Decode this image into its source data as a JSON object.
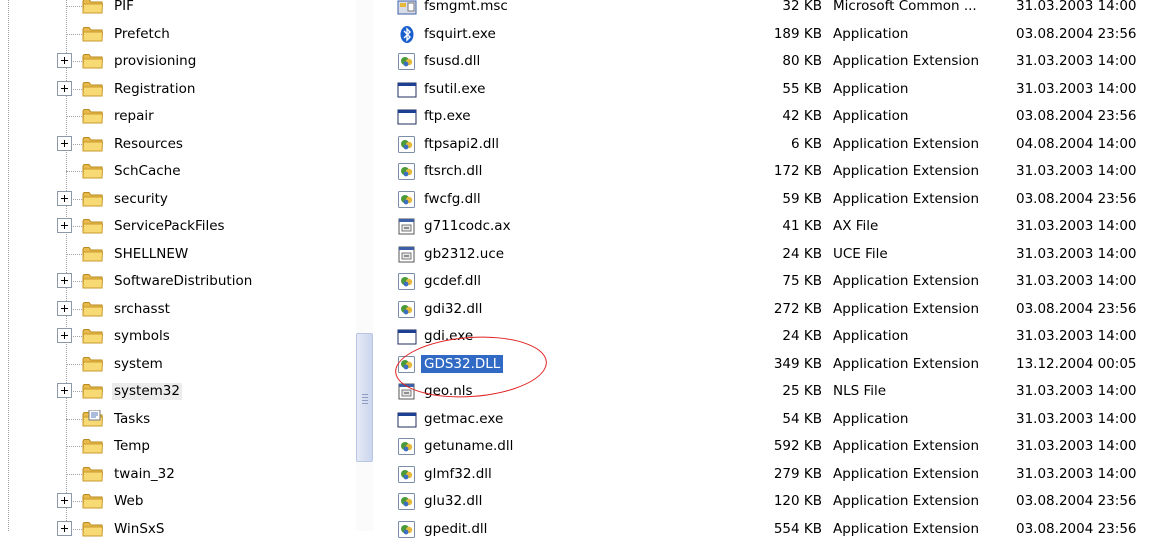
{
  "folder_tree": {
    "items": [
      {
        "label": "PIF",
        "expandable": false,
        "icon": "folder-icon"
      },
      {
        "label": "Prefetch",
        "expandable": false,
        "icon": "folder-icon"
      },
      {
        "label": "provisioning",
        "expandable": true,
        "icon": "folder-icon"
      },
      {
        "label": "Registration",
        "expandable": true,
        "icon": "folder-icon"
      },
      {
        "label": "repair",
        "expandable": false,
        "icon": "folder-icon"
      },
      {
        "label": "Resources",
        "expandable": true,
        "icon": "folder-icon"
      },
      {
        "label": "SchCache",
        "expandable": false,
        "icon": "folder-icon"
      },
      {
        "label": "security",
        "expandable": true,
        "icon": "folder-icon"
      },
      {
        "label": "ServicePackFiles",
        "expandable": true,
        "icon": "folder-icon"
      },
      {
        "label": "SHELLNEW",
        "expandable": false,
        "icon": "folder-icon"
      },
      {
        "label": "SoftwareDistribution",
        "expandable": true,
        "icon": "folder-icon"
      },
      {
        "label": "srchasst",
        "expandable": true,
        "icon": "folder-icon"
      },
      {
        "label": "symbols",
        "expandable": true,
        "icon": "folder-icon"
      },
      {
        "label": "system",
        "expandable": false,
        "icon": "folder-icon"
      },
      {
        "label": "system32",
        "expandable": true,
        "selected": true,
        "icon": "folder-icon"
      },
      {
        "label": "Tasks",
        "expandable": false,
        "icon": "tasks-folder-icon"
      },
      {
        "label": "Temp",
        "expandable": false,
        "icon": "folder-icon"
      },
      {
        "label": "twain_32",
        "expandable": false,
        "icon": "folder-icon"
      },
      {
        "label": "Web",
        "expandable": true,
        "icon": "folder-icon"
      },
      {
        "label": "WinSxS",
        "expandable": true,
        "icon": "folder-icon"
      }
    ]
  },
  "file_list": {
    "rows": [
      {
        "name": "fsmgmt.msc",
        "size": "32 KB",
        "type": "Microsoft Common ...",
        "modified": "31.03.2003 14:00",
        "icon": "msc-file-icon"
      },
      {
        "name": "fsquirt.exe",
        "size": "189 KB",
        "type": "Application",
        "modified": "03.08.2004 23:56",
        "icon": "bluetooth-icon"
      },
      {
        "name": "fsusd.dll",
        "size": "80 KB",
        "type": "Application Extension",
        "modified": "31.03.2003 14:00",
        "icon": "dll-icon"
      },
      {
        "name": "fsutil.exe",
        "size": "55 KB",
        "type": "Application",
        "modified": "31.03.2003 14:00",
        "icon": "exe-window-icon"
      },
      {
        "name": "ftp.exe",
        "size": "42 KB",
        "type": "Application",
        "modified": "03.08.2004 23:56",
        "icon": "exe-window-icon"
      },
      {
        "name": "ftpsapi2.dll",
        "size": "6 KB",
        "type": "Application Extension",
        "modified": "04.08.2004 14:00",
        "icon": "dll-icon"
      },
      {
        "name": "ftsrch.dll",
        "size": "172 KB",
        "type": "Application Extension",
        "modified": "31.03.2003 14:00",
        "icon": "dll-icon"
      },
      {
        "name": "fwcfg.dll",
        "size": "59 KB",
        "type": "Application Extension",
        "modified": "03.08.2004 23:56",
        "icon": "dll-icon"
      },
      {
        "name": "g711codc.ax",
        "size": "41 KB",
        "type": "AX File",
        "modified": "31.03.2003 14:00",
        "icon": "system-file-icon"
      },
      {
        "name": "gb2312.uce",
        "size": "24 KB",
        "type": "UCE File",
        "modified": "31.03.2003 14:00",
        "icon": "system-file-icon"
      },
      {
        "name": "gcdef.dll",
        "size": "75 KB",
        "type": "Application Extension",
        "modified": "31.03.2003 14:00",
        "icon": "dll-icon"
      },
      {
        "name": "gdi32.dll",
        "size": "272 KB",
        "type": "Application Extension",
        "modified": "03.08.2004 23:56",
        "icon": "dll-icon"
      },
      {
        "name": "gdi.exe",
        "size": "24 KB",
        "type": "Application",
        "modified": "31.03.2003 14:00",
        "icon": "exe-window-icon"
      },
      {
        "name": "GDS32.DLL",
        "size": "349 KB",
        "type": "Application Extension",
        "modified": "13.12.2004 00:05",
        "icon": "dll-icon",
        "selected": true
      },
      {
        "name": "geo.nls",
        "size": "25 KB",
        "type": "NLS File",
        "modified": "31.03.2003 14:00",
        "icon": "system-file-icon"
      },
      {
        "name": "getmac.exe",
        "size": "54 KB",
        "type": "Application",
        "modified": "31.03.2003 14:00",
        "icon": "exe-window-icon"
      },
      {
        "name": "getuname.dll",
        "size": "592 KB",
        "type": "Application Extension",
        "modified": "31.03.2003 14:00",
        "icon": "dll-icon"
      },
      {
        "name": "glmf32.dll",
        "size": "279 KB",
        "type": "Application Extension",
        "modified": "31.03.2003 14:00",
        "icon": "dll-icon"
      },
      {
        "name": "glu32.dll",
        "size": "120 KB",
        "type": "Application Extension",
        "modified": "03.08.2004 23:56",
        "icon": "dll-icon"
      },
      {
        "name": "gpedit.dll",
        "size": "554 KB",
        "type": "Application Extension",
        "modified": "03.08.2004 23:56",
        "icon": "dll-icon"
      }
    ]
  },
  "colors": {
    "selection": "#316ac5",
    "annotation": "#e02020",
    "folder": "#f5d46a"
  }
}
